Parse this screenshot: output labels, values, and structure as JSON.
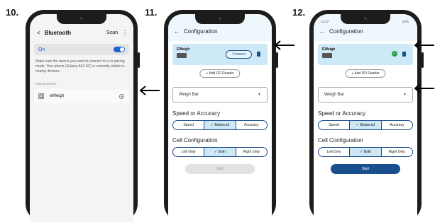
{
  "steps": [
    "10.",
    "11.",
    "12."
  ],
  "phone1": {
    "header": {
      "back": "<",
      "title": "Bluetooth",
      "scan": "Scan",
      "more": "⋮"
    },
    "on_label": "On",
    "message": "Make sure the device you want to connect to is in pairing mode. Your phone (Galaxy A32 5G) is currently visible to nearby devices.",
    "paired_label": "Paired devices",
    "device": {
      "name": "eWeigh",
      "icon": "grid-icon",
      "settings_icon": "gear-icon"
    }
  },
  "phone2": {
    "title": "Configuration",
    "device_name": "EWeigh",
    "connect_label": "Connect",
    "add_dd_label": "+ Add DD Reader",
    "weigh_bar_label": "Weigh Bar",
    "speed_heading": "Speed or Accuracy",
    "speed_options": [
      "Speed",
      "✓ Balanced",
      "Accuracy"
    ],
    "cell_heading": "Cell Configuration",
    "cell_options": [
      "Left Only",
      "✓ Both",
      "Right Only"
    ],
    "start_label": "Start"
  },
  "phone3": {
    "status_left": "12:27",
    "status_right": "22%",
    "title": "Configuration",
    "device_name": "EWeigh",
    "add_dd_label": "+ Add DD Reader",
    "weigh_bar_label": "Weigh Bar",
    "speed_heading": "Speed or Accuracy",
    "speed_options": [
      "Speed",
      "✓ Balanced",
      "Accuracy"
    ],
    "cell_heading": "Cell Configuration",
    "cell_options": [
      "Left Only",
      "✓ Both",
      "Right Only"
    ],
    "start_label": "Start"
  },
  "colors": {
    "accent": "#1a64d6",
    "navy": "#1a4f8e",
    "highlight": "#cde8f6",
    "disabled": "#e2e2e2",
    "start_active": "#1a4f8e"
  }
}
